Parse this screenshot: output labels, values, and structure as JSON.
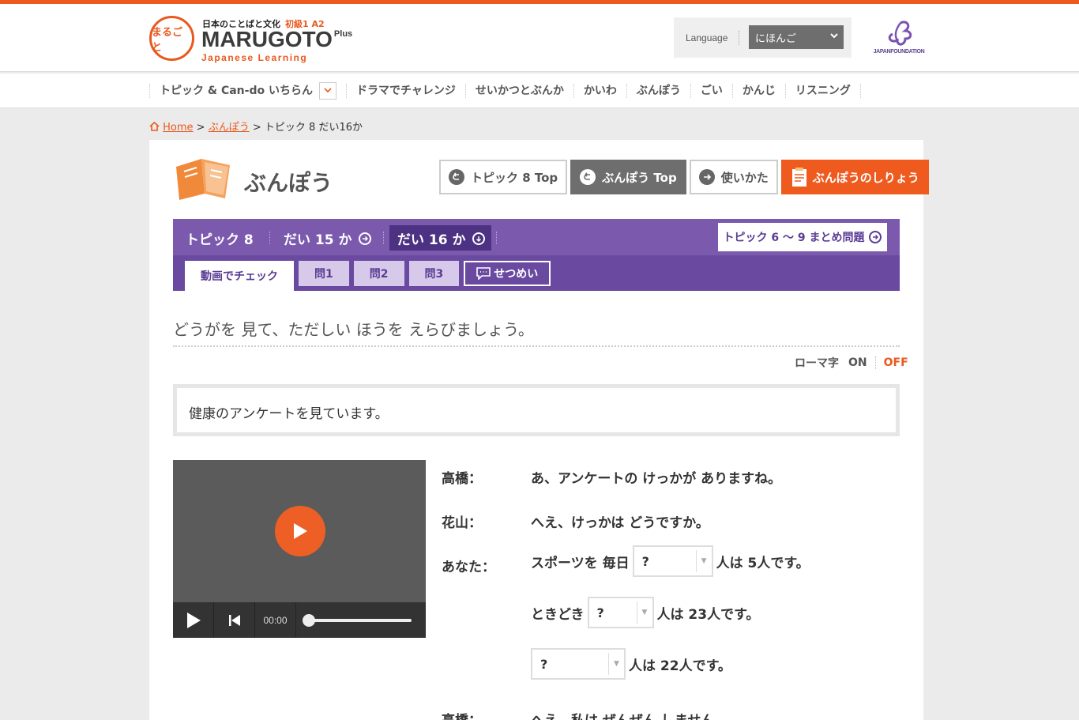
{
  "header": {
    "logo_mark": "まるごと",
    "logo_small": "日本のことばと文化",
    "logo_level": "初級1 A2",
    "logo_main": "MARUGOTO",
    "logo_plus": "Plus",
    "logo_sub": "Japanese Learning",
    "language_label": "Language",
    "language_value": "にほんご",
    "jf_text": "JAPANFOUNDATION"
  },
  "nav": {
    "items": [
      "トピック & Can-do いちらん",
      "ドラマでチャレンジ",
      "せいかつとぶんか",
      "かいわ",
      "ぶんぽう",
      "ごい",
      "かんじ",
      "リスニング"
    ]
  },
  "breadcrumb": {
    "home": "Home",
    "sep": ">",
    "section": "ぶんぽう",
    "current": "トピック 8 だい16か"
  },
  "section": {
    "title": "ぶんぽう",
    "buttons": [
      "トピック 8 Top",
      "ぶんぽう Top",
      "使いかた",
      "ぶんぽうのしりょう"
    ]
  },
  "lesson_bar": {
    "topic": "トピック 8",
    "lesson_prev": "だい 15 か",
    "lesson_current": "だい 16 か",
    "summary": "トピック 6 〜 9 まとめ問題",
    "tabs": [
      "動画でチェック",
      "問1",
      "問2",
      "問3",
      "せつめい"
    ]
  },
  "content": {
    "instruction": "どうがを 見て、ただしい ほうを えらびましょう。",
    "romaji_label": "ローマ字",
    "romaji_on": "ON",
    "romaji_off": "OFF",
    "context": "健康のアンケートを見ています。"
  },
  "video": {
    "time": "00:00",
    "progress": 0
  },
  "dialogue": {
    "s1": "高橋：",
    "l1": "あ、アンケートの けっかが ありますね。",
    "s2": "花山：",
    "l2": "へえ、けっかは どうですか。",
    "s3": "あなた：",
    "l3a": "スポーツを 毎日",
    "l3b": "人は 5人です。",
    "l4a": "ときどき",
    "l4b": "人は 23人です。",
    "l5b": "人は 22人です。",
    "select_value": "?",
    "s4": "高橋：",
    "l6": "へえ、私は ぜんぜん しません。"
  },
  "colors": {
    "accent": "#ee5a1e",
    "purple": "#6a4aa0",
    "gray_button": "#6e6e6e"
  }
}
